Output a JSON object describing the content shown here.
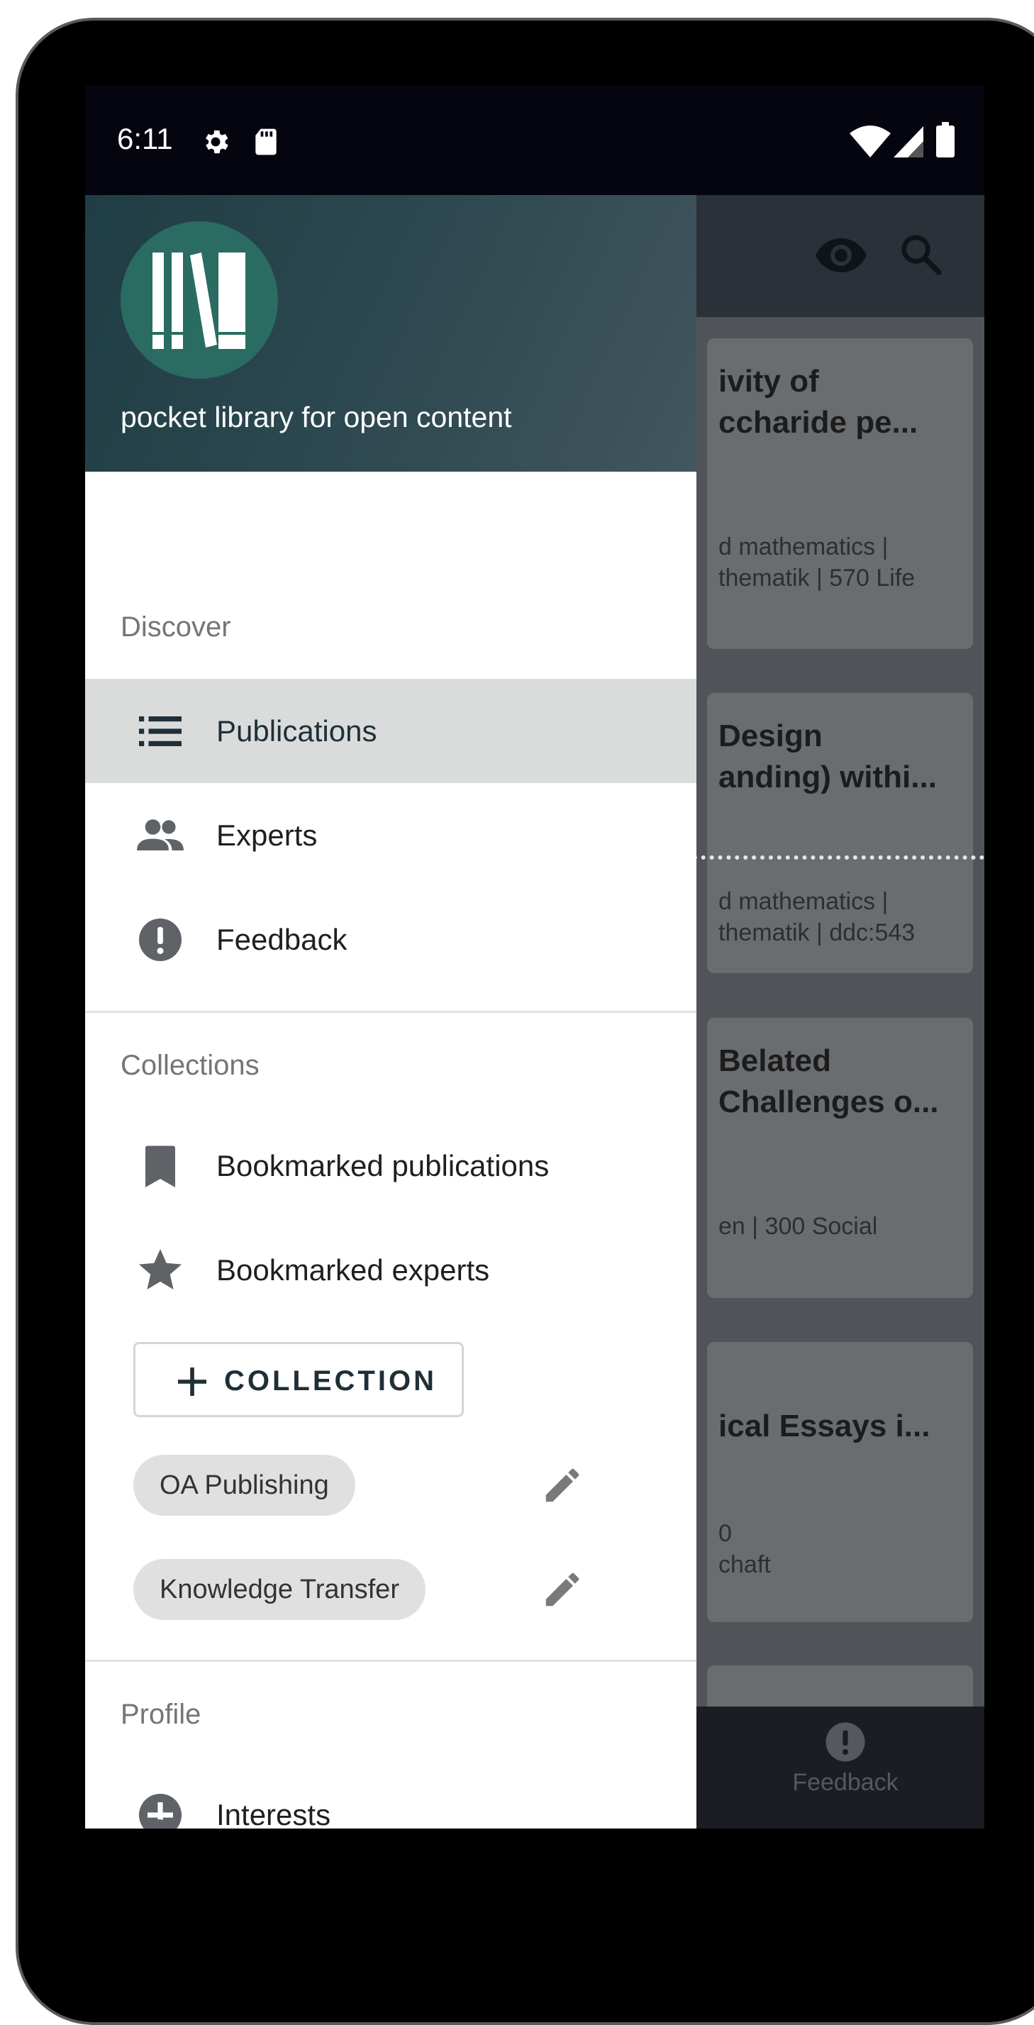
{
  "status_bar": {
    "time": "6:11"
  },
  "drawer": {
    "header": {
      "tagline": "pocket library for open content"
    },
    "discover": {
      "label": "Discover",
      "items": [
        {
          "label": "Publications",
          "icon": "list-icon",
          "selected": true
        },
        {
          "label": "Experts",
          "icon": "people-icon"
        },
        {
          "label": "Feedback",
          "icon": "alert-circle-icon"
        }
      ]
    },
    "collections": {
      "label": "Collections",
      "items": [
        {
          "label": "Bookmarked publications",
          "icon": "bookmark-icon"
        },
        {
          "label": "Bookmarked experts",
          "icon": "star-icon"
        }
      ],
      "add_button": "COLLECTION",
      "chips": [
        {
          "label": "OA Publishing"
        },
        {
          "label": "Knowledge Transfer"
        }
      ]
    },
    "profile": {
      "label": "Profile",
      "items": [
        {
          "label": "Interests",
          "icon": "add-circle-icon"
        }
      ]
    }
  },
  "background_app": {
    "cards": [
      {
        "title_line1": "ivity of",
        "title_line2": "ccharide pe...",
        "meta_line1": "d mathematics |",
        "meta_line2": "thematik | 570 Life"
      },
      {
        "title_line1": "Design",
        "title_line2": "anding) withi...",
        "meta_line1": "d mathematics |",
        "meta_line2": "thematik | ddc:543"
      },
      {
        "title_line1": "Belated",
        "title_line2": "Challenges o...",
        "meta_line1": "en | 300 Social",
        "meta_line2": ""
      },
      {
        "title_line1": "",
        "title_line2": "ical Essays i...",
        "meta_line1": "0",
        "meta_line2": "chaft"
      }
    ],
    "bottom_nav": {
      "feedback_label": "Feedback"
    }
  },
  "colors": {
    "header_gradient_start": "#1f3d44",
    "header_gradient_end": "#42565e",
    "logo_circle": "#2a6b62",
    "selected_item_bg": "#dadcdc"
  }
}
